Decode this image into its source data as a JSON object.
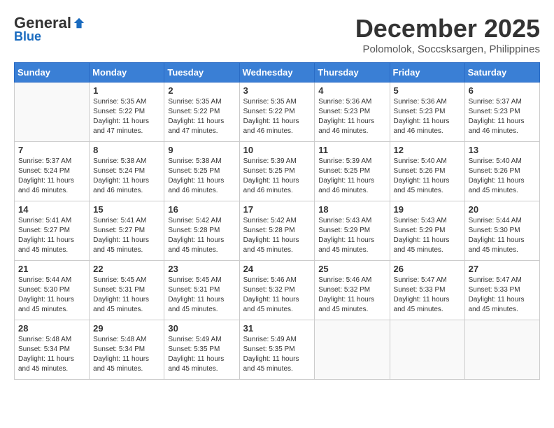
{
  "header": {
    "logo": {
      "general": "General",
      "blue": "Blue",
      "tagline": ""
    },
    "title": "December 2025",
    "subtitle": "Polomolok, Soccsksargen, Philippines"
  },
  "calendar": {
    "weekdays": [
      "Sunday",
      "Monday",
      "Tuesday",
      "Wednesday",
      "Thursday",
      "Friday",
      "Saturday"
    ],
    "weeks": [
      [
        {
          "day": "",
          "sunrise": "",
          "sunset": "",
          "daylight": ""
        },
        {
          "day": "1",
          "sunrise": "Sunrise: 5:35 AM",
          "sunset": "Sunset: 5:22 PM",
          "daylight": "Daylight: 11 hours and 47 minutes."
        },
        {
          "day": "2",
          "sunrise": "Sunrise: 5:35 AM",
          "sunset": "Sunset: 5:22 PM",
          "daylight": "Daylight: 11 hours and 47 minutes."
        },
        {
          "day": "3",
          "sunrise": "Sunrise: 5:35 AM",
          "sunset": "Sunset: 5:22 PM",
          "daylight": "Daylight: 11 hours and 46 minutes."
        },
        {
          "day": "4",
          "sunrise": "Sunrise: 5:36 AM",
          "sunset": "Sunset: 5:23 PM",
          "daylight": "Daylight: 11 hours and 46 minutes."
        },
        {
          "day": "5",
          "sunrise": "Sunrise: 5:36 AM",
          "sunset": "Sunset: 5:23 PM",
          "daylight": "Daylight: 11 hours and 46 minutes."
        },
        {
          "day": "6",
          "sunrise": "Sunrise: 5:37 AM",
          "sunset": "Sunset: 5:23 PM",
          "daylight": "Daylight: 11 hours and 46 minutes."
        }
      ],
      [
        {
          "day": "7",
          "sunrise": "Sunrise: 5:37 AM",
          "sunset": "Sunset: 5:24 PM",
          "daylight": "Daylight: 11 hours and 46 minutes."
        },
        {
          "day": "8",
          "sunrise": "Sunrise: 5:38 AM",
          "sunset": "Sunset: 5:24 PM",
          "daylight": "Daylight: 11 hours and 46 minutes."
        },
        {
          "day": "9",
          "sunrise": "Sunrise: 5:38 AM",
          "sunset": "Sunset: 5:25 PM",
          "daylight": "Daylight: 11 hours and 46 minutes."
        },
        {
          "day": "10",
          "sunrise": "Sunrise: 5:39 AM",
          "sunset": "Sunset: 5:25 PM",
          "daylight": "Daylight: 11 hours and 46 minutes."
        },
        {
          "day": "11",
          "sunrise": "Sunrise: 5:39 AM",
          "sunset": "Sunset: 5:25 PM",
          "daylight": "Daylight: 11 hours and 46 minutes."
        },
        {
          "day": "12",
          "sunrise": "Sunrise: 5:40 AM",
          "sunset": "Sunset: 5:26 PM",
          "daylight": "Daylight: 11 hours and 45 minutes."
        },
        {
          "day": "13",
          "sunrise": "Sunrise: 5:40 AM",
          "sunset": "Sunset: 5:26 PM",
          "daylight": "Daylight: 11 hours and 45 minutes."
        }
      ],
      [
        {
          "day": "14",
          "sunrise": "Sunrise: 5:41 AM",
          "sunset": "Sunset: 5:27 PM",
          "daylight": "Daylight: 11 hours and 45 minutes."
        },
        {
          "day": "15",
          "sunrise": "Sunrise: 5:41 AM",
          "sunset": "Sunset: 5:27 PM",
          "daylight": "Daylight: 11 hours and 45 minutes."
        },
        {
          "day": "16",
          "sunrise": "Sunrise: 5:42 AM",
          "sunset": "Sunset: 5:28 PM",
          "daylight": "Daylight: 11 hours and 45 minutes."
        },
        {
          "day": "17",
          "sunrise": "Sunrise: 5:42 AM",
          "sunset": "Sunset: 5:28 PM",
          "daylight": "Daylight: 11 hours and 45 minutes."
        },
        {
          "day": "18",
          "sunrise": "Sunrise: 5:43 AM",
          "sunset": "Sunset: 5:29 PM",
          "daylight": "Daylight: 11 hours and 45 minutes."
        },
        {
          "day": "19",
          "sunrise": "Sunrise: 5:43 AM",
          "sunset": "Sunset: 5:29 PM",
          "daylight": "Daylight: 11 hours and 45 minutes."
        },
        {
          "day": "20",
          "sunrise": "Sunrise: 5:44 AM",
          "sunset": "Sunset: 5:30 PM",
          "daylight": "Daylight: 11 hours and 45 minutes."
        }
      ],
      [
        {
          "day": "21",
          "sunrise": "Sunrise: 5:44 AM",
          "sunset": "Sunset: 5:30 PM",
          "daylight": "Daylight: 11 hours and 45 minutes."
        },
        {
          "day": "22",
          "sunrise": "Sunrise: 5:45 AM",
          "sunset": "Sunset: 5:31 PM",
          "daylight": "Daylight: 11 hours and 45 minutes."
        },
        {
          "day": "23",
          "sunrise": "Sunrise: 5:45 AM",
          "sunset": "Sunset: 5:31 PM",
          "daylight": "Daylight: 11 hours and 45 minutes."
        },
        {
          "day": "24",
          "sunrise": "Sunrise: 5:46 AM",
          "sunset": "Sunset: 5:32 PM",
          "daylight": "Daylight: 11 hours and 45 minutes."
        },
        {
          "day": "25",
          "sunrise": "Sunrise: 5:46 AM",
          "sunset": "Sunset: 5:32 PM",
          "daylight": "Daylight: 11 hours and 45 minutes."
        },
        {
          "day": "26",
          "sunrise": "Sunrise: 5:47 AM",
          "sunset": "Sunset: 5:33 PM",
          "daylight": "Daylight: 11 hours and 45 minutes."
        },
        {
          "day": "27",
          "sunrise": "Sunrise: 5:47 AM",
          "sunset": "Sunset: 5:33 PM",
          "daylight": "Daylight: 11 hours and 45 minutes."
        }
      ],
      [
        {
          "day": "28",
          "sunrise": "Sunrise: 5:48 AM",
          "sunset": "Sunset: 5:34 PM",
          "daylight": "Daylight: 11 hours and 45 minutes."
        },
        {
          "day": "29",
          "sunrise": "Sunrise: 5:48 AM",
          "sunset": "Sunset: 5:34 PM",
          "daylight": "Daylight: 11 hours and 45 minutes."
        },
        {
          "day": "30",
          "sunrise": "Sunrise: 5:49 AM",
          "sunset": "Sunset: 5:35 PM",
          "daylight": "Daylight: 11 hours and 45 minutes."
        },
        {
          "day": "31",
          "sunrise": "Sunrise: 5:49 AM",
          "sunset": "Sunset: 5:35 PM",
          "daylight": "Daylight: 11 hours and 45 minutes."
        },
        {
          "day": "",
          "sunrise": "",
          "sunset": "",
          "daylight": ""
        },
        {
          "day": "",
          "sunrise": "",
          "sunset": "",
          "daylight": ""
        },
        {
          "day": "",
          "sunrise": "",
          "sunset": "",
          "daylight": ""
        }
      ]
    ]
  }
}
